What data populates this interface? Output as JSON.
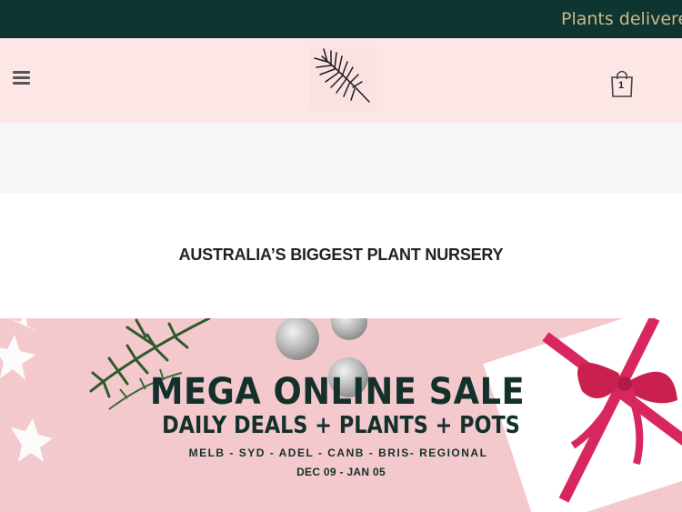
{
  "announcement": {
    "text": "Plants delivered"
  },
  "header": {
    "cart_count": "1"
  },
  "tagline": "AUSTRALIA’S BIGGEST PLANT NURSERY",
  "banner": {
    "title": "MEGA ONLINE SALE",
    "subtitle": "DAILY DEALS + PLANTS + POTS",
    "cities": "MELB - SYD - ADEL - CANB - BRIS- REGIONAL",
    "dates": "DEC 09 - JAN 05"
  },
  "icons": {
    "menu": "hamburger-menu-icon",
    "logo": "palm-leaf-logo",
    "cart": "shopping-bag-icon"
  },
  "colors": {
    "announce_bg": "#0f3530",
    "announce_text": "#c9b98a",
    "header_bg": "#fde6e6",
    "banner_bg": "#f4c9cd",
    "banner_text": "#13302b"
  }
}
